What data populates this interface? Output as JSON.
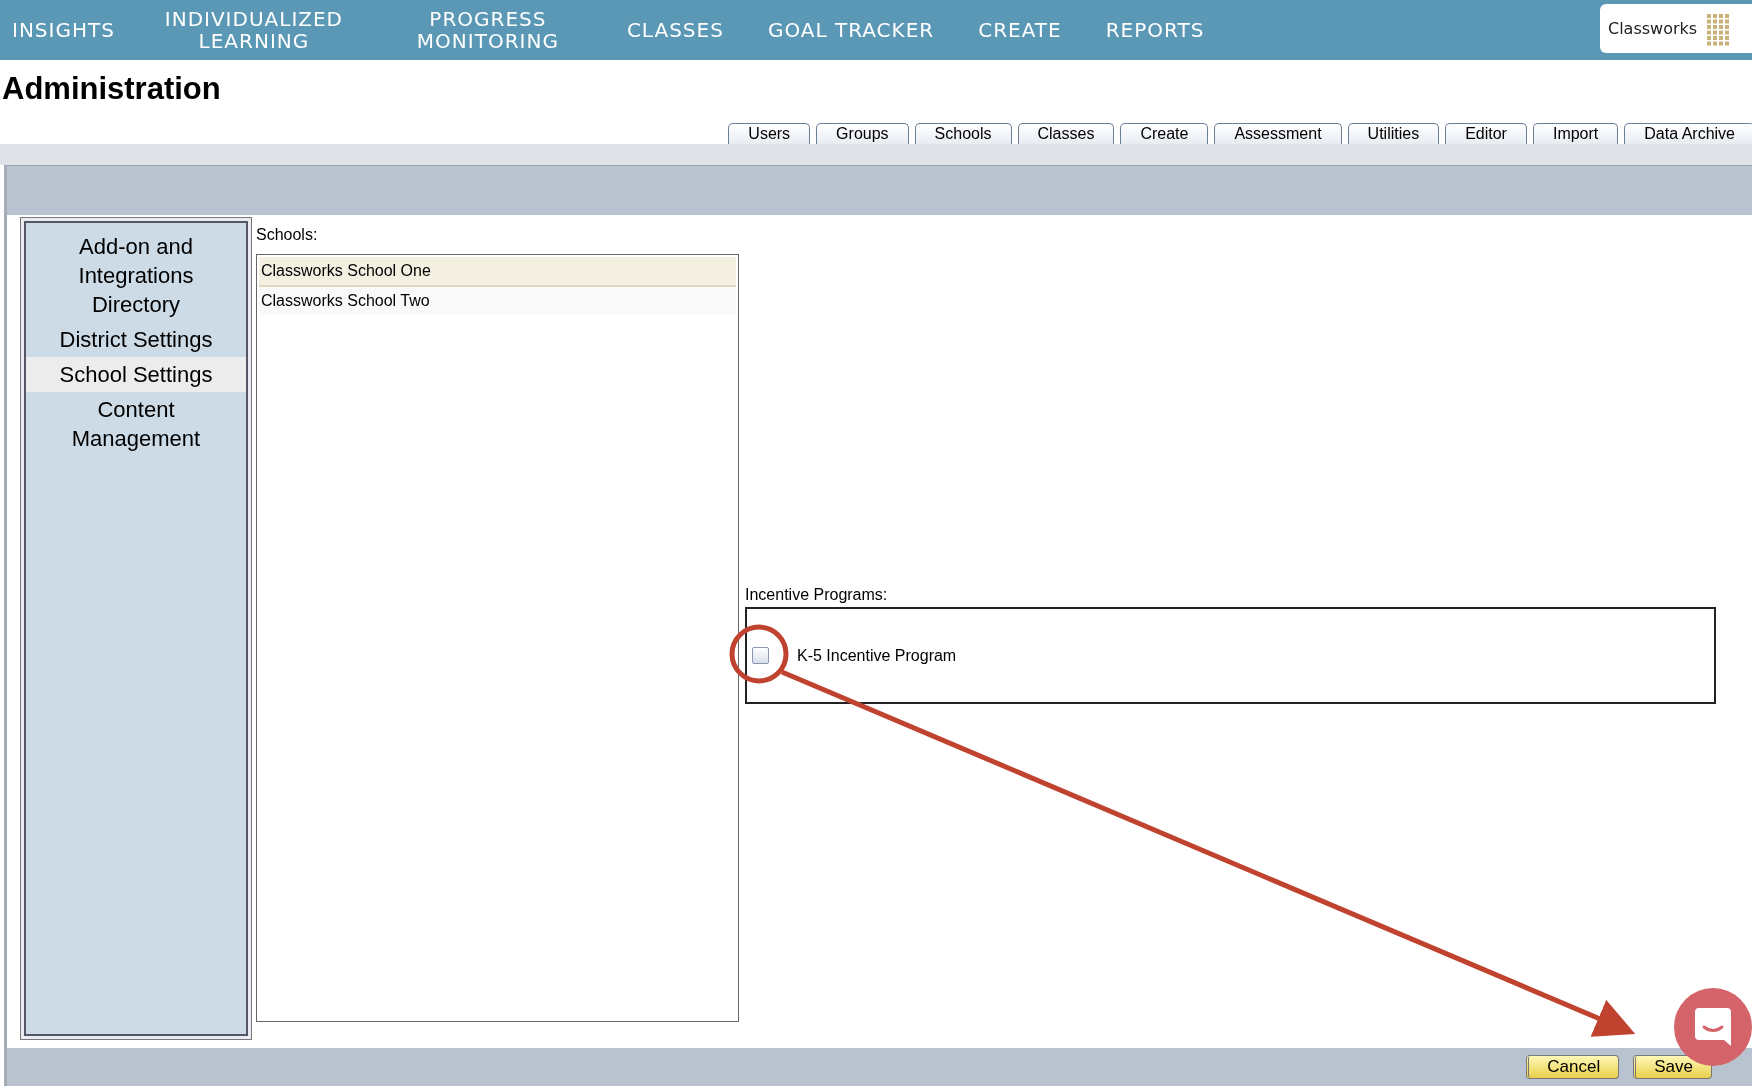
{
  "nav": {
    "items": [
      {
        "label": "INSIGHTS"
      },
      {
        "label": "INDIVIDUALIZED LEARNING"
      },
      {
        "label": "PROGRESS MONITORING"
      },
      {
        "label": "CLASSES"
      },
      {
        "label": "GOAL TRACKER"
      },
      {
        "label": "CREATE"
      },
      {
        "label": "REPORTS"
      }
    ]
  },
  "logo": {
    "text": "Classworks"
  },
  "page_title": "Administration",
  "tabs": [
    {
      "label": "Users"
    },
    {
      "label": "Groups"
    },
    {
      "label": "Schools"
    },
    {
      "label": "Classes"
    },
    {
      "label": "Create"
    },
    {
      "label": "Assessment"
    },
    {
      "label": "Utilities"
    },
    {
      "label": "Editor"
    },
    {
      "label": "Import"
    },
    {
      "label": "Data Archive"
    }
  ],
  "sidebar": {
    "items": [
      {
        "label": "Add-on and Integrations Directory",
        "selected": false
      },
      {
        "label": "District Settings",
        "selected": false
      },
      {
        "label": "School Settings",
        "selected": true
      },
      {
        "label": "Content Management",
        "selected": false
      }
    ]
  },
  "schools": {
    "label": "Schools:",
    "items": [
      {
        "name": "Classworks School One",
        "selected": true
      },
      {
        "name": "Classworks School Two",
        "selected": false
      }
    ]
  },
  "incentive_programs": {
    "label": "Incentive Programs:",
    "items": [
      {
        "label": "K-5 Incentive Program",
        "checked": false
      }
    ]
  },
  "buttons": [
    {
      "label": "Cancel"
    },
    {
      "label": "Save"
    }
  ]
}
